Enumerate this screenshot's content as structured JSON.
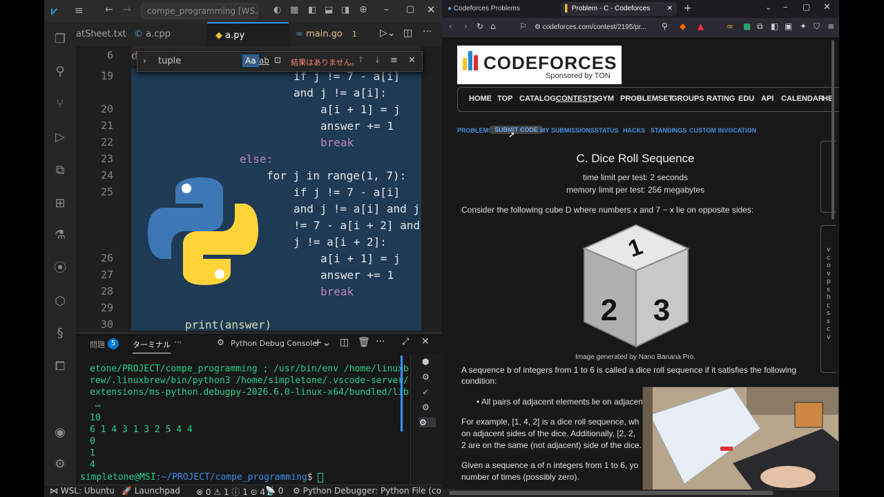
{
  "vscode": {
    "search_box": "compe_programming [WS...",
    "tabs": [
      "atSheet.txt",
      "a.cpp",
      "a.py",
      "main.go"
    ],
    "tab_badge": "1",
    "find": {
      "query": "tuple",
      "aa": "Aa",
      "ab": "ab",
      "result": "結果はありません。"
    },
    "line_numbers": [
      "6",
      "19",
      "20",
      "21",
      "22",
      "23",
      "24",
      "25",
      "26",
      "27",
      "28",
      "29",
      "30"
    ],
    "code": {
      "l19": "if j != 7 - a[i]",
      "l19b": "and j != a[i]:",
      "l20": "a[i + 1] = j",
      "l21": "answer += 1",
      "l22": "break",
      "l23": "else:",
      "l24": "for j in range(1, 7):",
      "l25": "if j != 7 - a[i]",
      "l25b": "and j != a[i] and j",
      "l25c": "!= 7 - a[i + 2] and",
      "l25d": "j != a[i + 2]:",
      "l26": "a[i + 1] = j",
      "l27": "answer += 1",
      "l28": "break",
      "l30": "print(answer)"
    },
    "panel": {
      "problems": "問題",
      "problems_count": "5",
      "terminal": "ターミナル",
      "more": "···",
      "debug_console": "Python Debug Console"
    },
    "terminal": [
      "etone/PROJECT/compe_programming ; /usr/bin/env /home/linuxb",
      "rew/.linuxbrew/bin/python3 /home/simpletone/.vscode-server/",
      "extensions/ms-python.debugpy-2026.6.0-linux-x64/bundled/lib",
      " …",
      "10",
      "6 1 4 3 1 3 2 5 4 4",
      "0",
      "1",
      "4"
    ],
    "prompt_user": "simpletone@MSI",
    "prompt_path": ":~/PROJECT/compe_programming",
    "prompt_symbol": "$",
    "status": {
      "wsl": "WSL: Ubuntu",
      "launchpad": "Launchpad",
      "errors": "0",
      "warnings": "1",
      "info": "1",
      "info2": "4",
      "ports": "0",
      "debugger": "Python Debugger: Python File (compe"
    }
  },
  "browser": {
    "tabs": [
      "Codeforces Problems",
      "Problem - C - Codeforces"
    ],
    "url": "codeforces.com/contest/2195/pr...",
    "logo_text": "CODEFORCES",
    "sponsor": "Sponsored by TON",
    "menu": [
      "HOME",
      "TOP",
      "CATALOG",
      "CONTESTS",
      "GYM",
      "PROBLEMSET",
      "GROUPS",
      "RATING",
      "EDU",
      "API",
      "CALENDAR",
      "HE"
    ],
    "submenu": [
      "PROBLEMS",
      "SUBMIT CODE",
      "MY SUBMISSIONS",
      "STATUS",
      "HACKS",
      "STANDINGS",
      "CUSTOM INVOCATION"
    ],
    "problem": {
      "title": "C. Dice Roll Sequence",
      "time_limit": "time limit per test: 2 seconds",
      "memory_limit": "memory limit per test: 256 megabytes",
      "intro": "Consider the following cube D where numbers x and 7 − x lie on opposite sides:",
      "dice_numbers": [
        "1",
        "2",
        "3"
      ],
      "caption": "Image generated by Nano Banana Pro.",
      "p1a": "A sequence b of integers from 1 to 6 is called a dice roll sequence if it satisfies the following",
      "p1b": "condition:",
      "bullet": "All pairs of adjacent elements lie on adjacent",
      "p2a": "For example, [1, 4, 2] is a dice roll sequence, wh",
      "p2b": "on adjacent sides of the dice. Additionally, [2, 2, ",
      "p2c": "2 are on the same (not adjacent) side of the dice.",
      "p3a": "Given a sequence a of n integers from 1 to 6, yo",
      "p3b": "number of times (possibly zero)."
    },
    "side_letters": [
      "v",
      "c",
      "o",
      "v",
      "p",
      "s",
      "h",
      "c",
      "s",
      "s",
      "c",
      "v"
    ]
  }
}
